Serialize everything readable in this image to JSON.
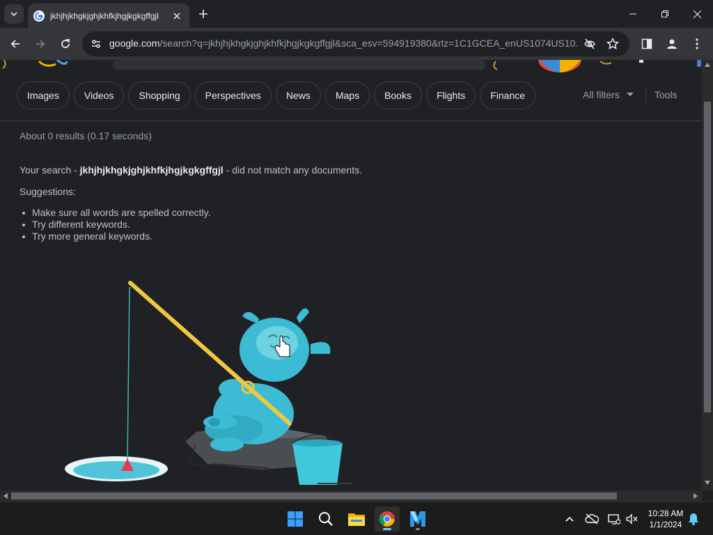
{
  "browser": {
    "tab": {
      "title": "jkhjhjkhgkjghjkhfkjhgjkgkgffgjl"
    },
    "url": {
      "host": "google.com",
      "path": "/search?q=jkhjhjkhgkjghjkhfkjhgjkgkgffgjl&sca_esv=594919380&rlz=1C1GCEA_enUS1074US10..."
    },
    "icons": {
      "tab_search": "chevron-down-icon",
      "new_tab": "plus-icon",
      "minimize": "minimize-icon",
      "restore": "restore-icon",
      "close": "close-icon",
      "back": "back-arrow-icon",
      "forward": "forward-arrow-icon",
      "reload": "reload-icon",
      "site_info": "tune-icon",
      "eye_off": "eye-off-icon",
      "bookmark": "star-icon",
      "side_panel": "side-panel-icon",
      "profile": "profile-icon",
      "menu": "kebab-menu-icon"
    }
  },
  "search": {
    "chips": [
      "Images",
      "Videos",
      "Shopping",
      "Perspectives",
      "News",
      "Maps",
      "Books",
      "Flights",
      "Finance"
    ],
    "all_filters": "All filters",
    "tools": "Tools",
    "stats": "About 0 results (0.17 seconds)",
    "no_match_prefix": "Your search - ",
    "query": "jkhjhjkhgkjghjkhfkjhgjkgkgffgjl",
    "no_match_suffix": " - did not match any documents.",
    "suggestions_title": "Suggestions:",
    "suggestions": [
      "Make sure all words are spelled correctly.",
      "Try different keywords.",
      "Try more general keywords."
    ]
  },
  "taskbar": {
    "apps": [
      "windows-start-icon",
      "search-icon",
      "file-explorer-icon",
      "chrome-icon",
      "app-icon"
    ],
    "time": "10:28 AM",
    "date": "1/1/2024"
  },
  "colors": {
    "background": "#202124",
    "toolbar": "#35363a",
    "chip_border": "#3c4043",
    "text": "#e8eaed",
    "muted": "#9aa0a6",
    "yeti": "#3bbcd4"
  }
}
